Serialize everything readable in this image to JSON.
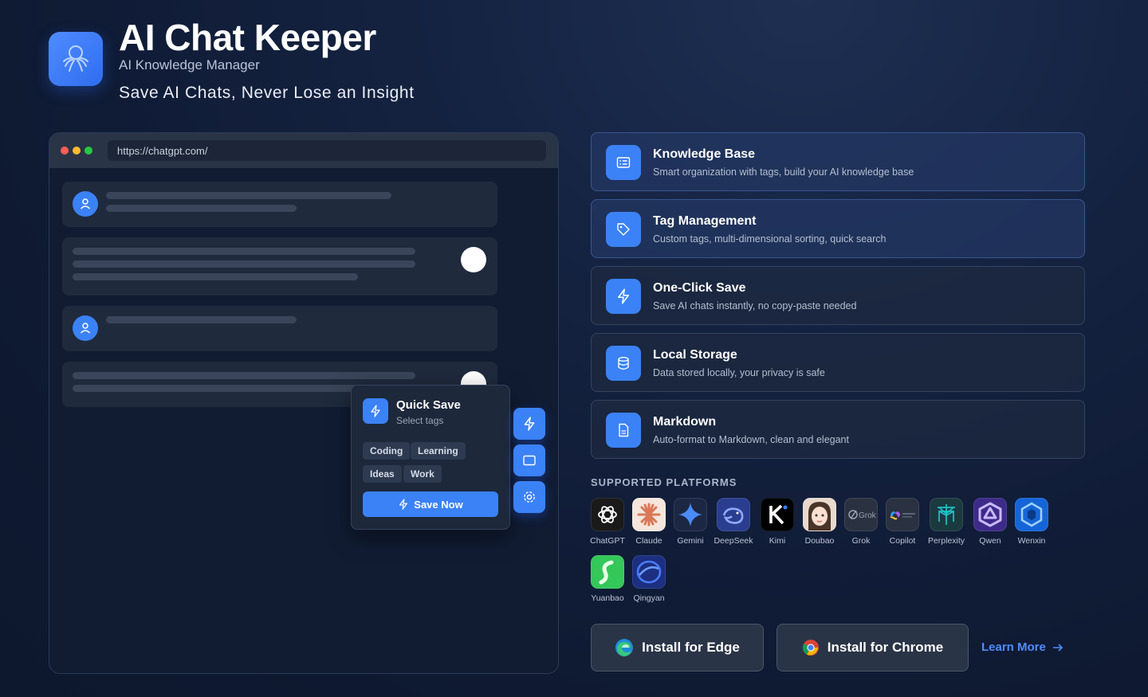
{
  "header": {
    "title": "AI Chat Keeper",
    "subtitle": "AI Knowledge Manager",
    "tagline": "Save AI Chats, Never Lose an Insight"
  },
  "browser": {
    "url": "https://chatgpt.com/"
  },
  "quick_save": {
    "title": "Quick Save",
    "subtitle": "Select tags",
    "tags": [
      "Coding",
      "Learning",
      "Ideas",
      "Work"
    ],
    "save_label": "Save Now"
  },
  "features": [
    {
      "title": "Knowledge Base",
      "desc": "Smart organization with tags, build your AI knowledge base",
      "icon": "list-icon"
    },
    {
      "title": "Tag Management",
      "desc": "Custom tags, multi-dimensional sorting, quick search",
      "icon": "tag-icon"
    },
    {
      "title": "One-Click Save",
      "desc": "Save AI chats instantly, no copy-paste needed",
      "icon": "lightning-icon"
    },
    {
      "title": "Local Storage",
      "desc": "Data stored locally, your privacy is safe",
      "icon": "database-icon"
    },
    {
      "title": "Markdown",
      "desc": "Auto-format to Markdown, clean and elegant",
      "icon": "document-icon"
    }
  ],
  "platforms_label": "SUPPORTED PLATFORMS",
  "platforms": [
    "ChatGPT",
    "Claude",
    "Gemini",
    "DeepSeek",
    "Kimi",
    "Doubao",
    "Grok",
    "Copilot",
    "Perplexity",
    "Qwen",
    "Wenxin",
    "Yuanbao",
    "Qingyan"
  ],
  "actions": {
    "edge": "Install for Edge",
    "chrome": "Install for Chrome",
    "learn_more": "Learn More"
  },
  "colors": {
    "accent": "#3b82f6",
    "background": "#0f1a33"
  }
}
